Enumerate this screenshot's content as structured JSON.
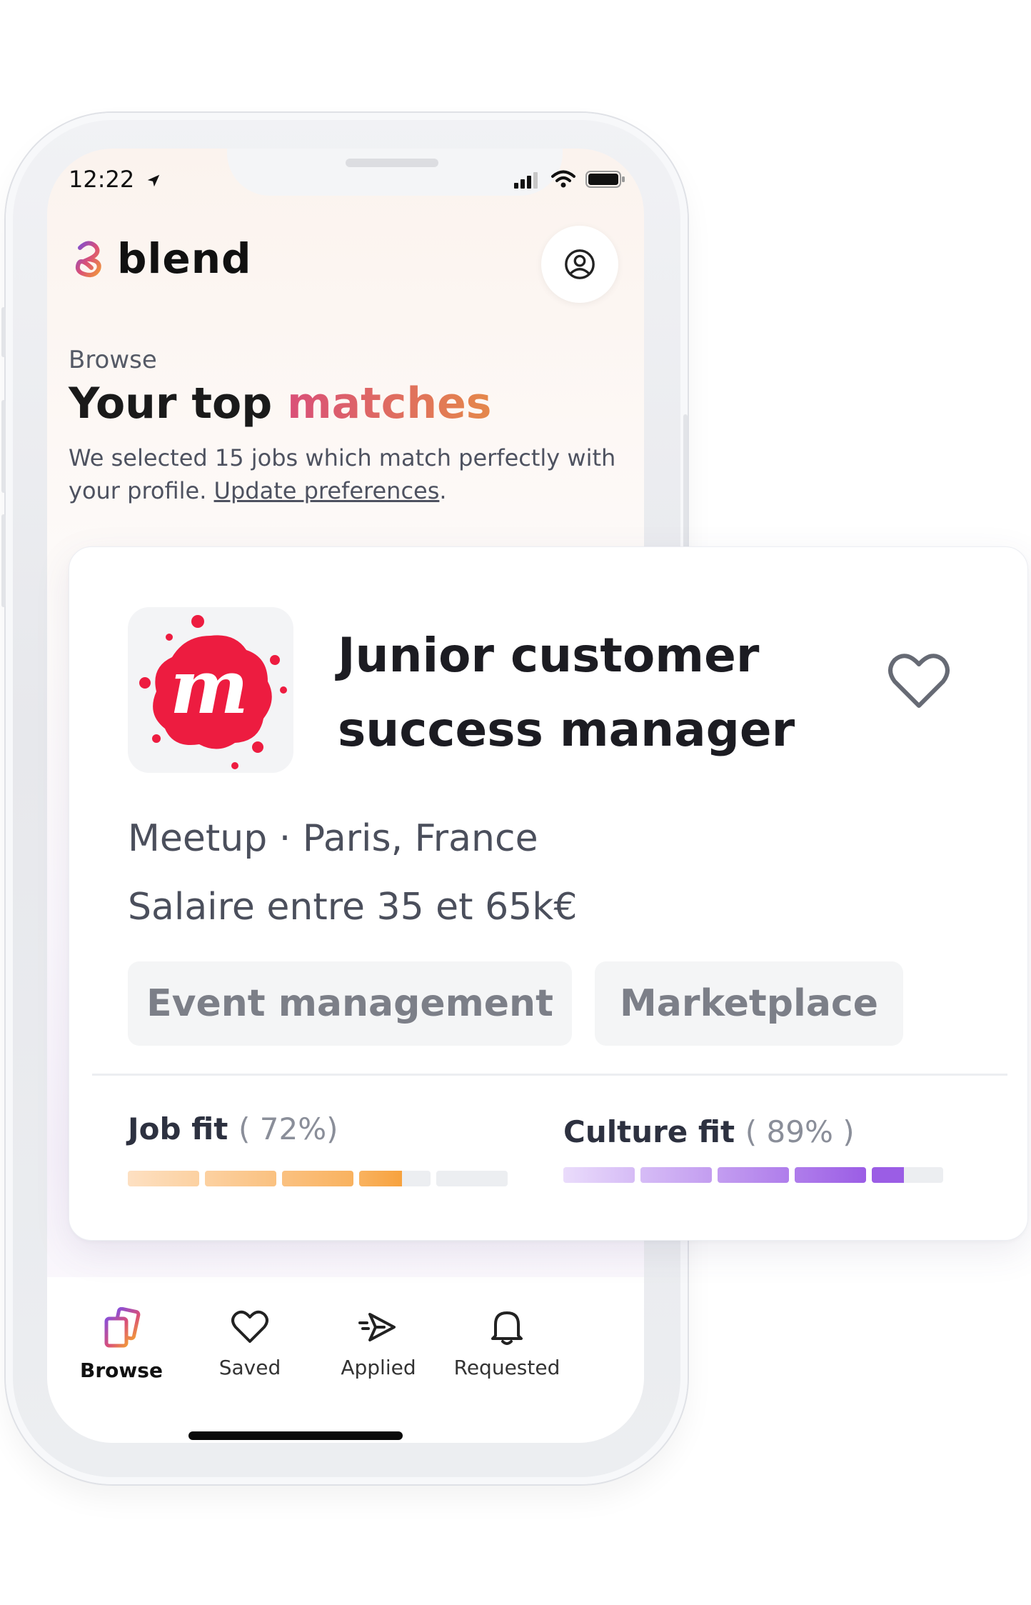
{
  "status_bar": {
    "time": "12:22"
  },
  "app": {
    "name": "blend"
  },
  "header": {
    "breadcrumb": "Browse",
    "title_plain": "Your top ",
    "title_accent": "matches",
    "subtitle_text": "We selected 15 jobs which match perfectly with your profile. ",
    "subtitle_link": "Update preferences",
    "subtitle_end": "."
  },
  "job": {
    "title_line1": "Junior customer",
    "title_line2": "success manager",
    "company": "Meetup",
    "location": "Paris, France",
    "location_line": "Meetup · Paris, France",
    "salary": "Salaire entre 35 et 65k€",
    "tags": [
      "Event management",
      "Marketplace"
    ],
    "job_fit": {
      "label": "Job fit",
      "pct_text": "( 72%)",
      "value": 0.72
    },
    "culture_fit": {
      "label": "Culture fit",
      "pct_text": "( 89% )",
      "value": 0.89
    },
    "company_logo_letter": "m"
  },
  "bottom_nav": [
    {
      "label": "Browse",
      "icon": "browse-cards-icon",
      "active": true
    },
    {
      "label": "Saved",
      "icon": "heart-icon",
      "active": false
    },
    {
      "label": "Applied",
      "icon": "send-icon",
      "active": false
    },
    {
      "label": "Requested",
      "icon": "bell-icon",
      "active": false
    }
  ],
  "colors": {
    "brand_pink": "#d94f78",
    "brand_orange": "#e5884a",
    "job_fit_orange": "#f7a23e",
    "culture_fit_purple": "#9b5de5",
    "meetup_red": "#ed1c40"
  }
}
